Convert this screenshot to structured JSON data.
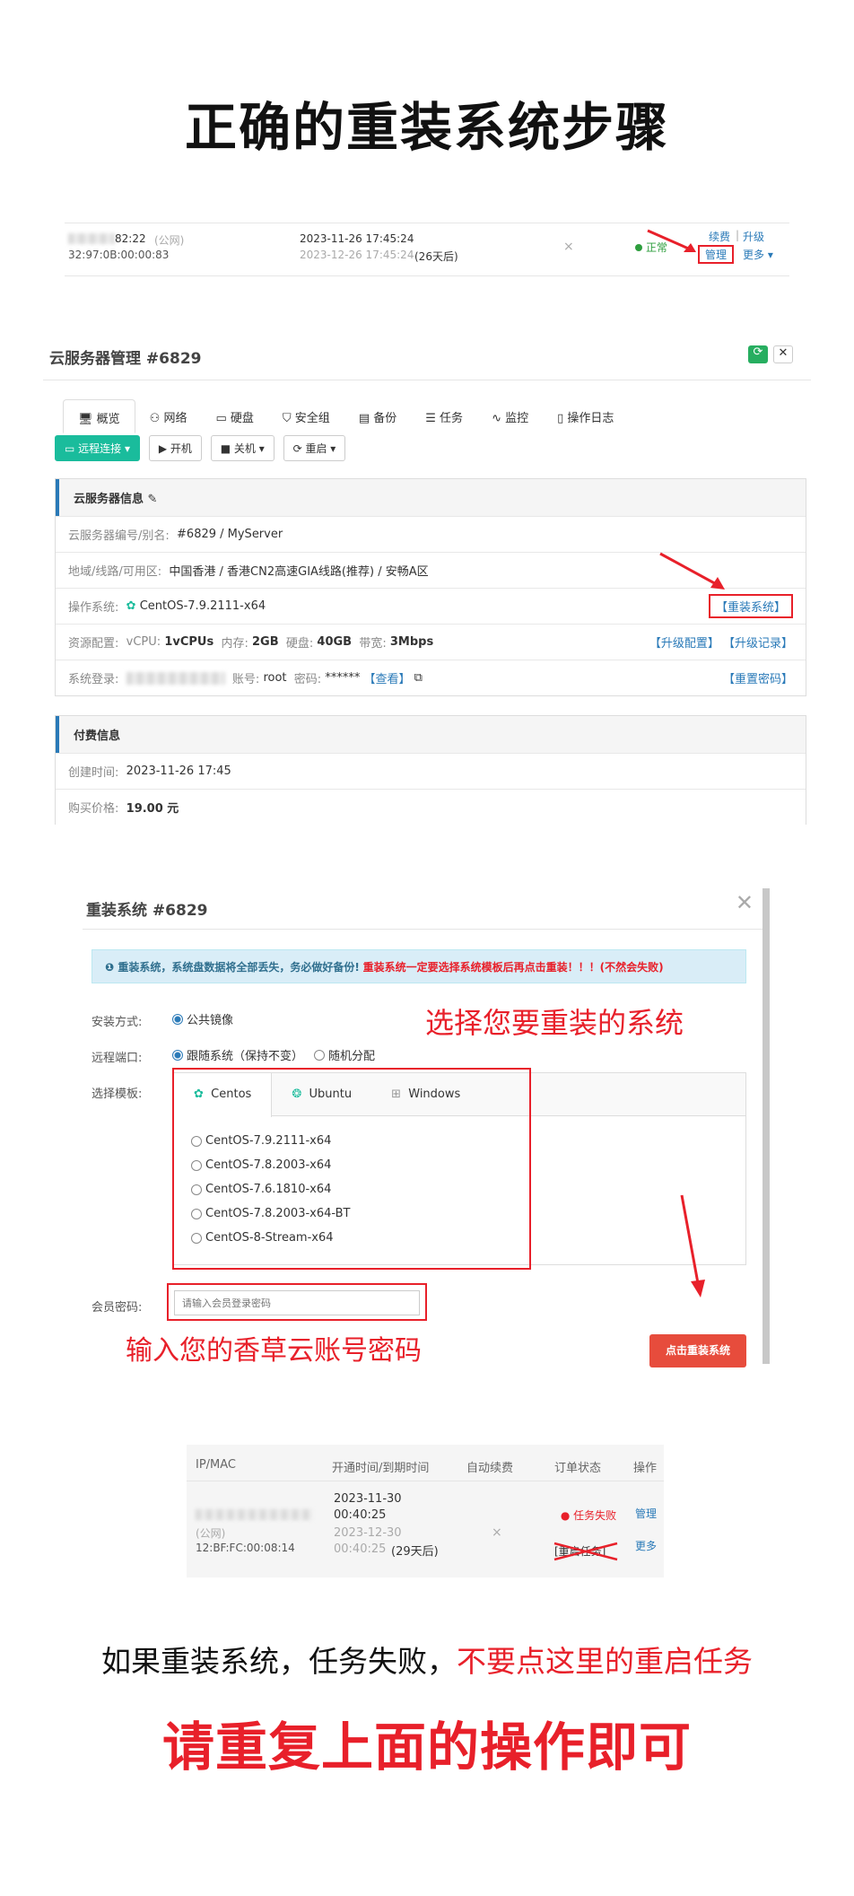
{
  "title": "正确的重装系统步骤",
  "list1": {
    "ip": "82:22",
    "ip_type": "(公网)",
    "mac": "32:97:0B:00:00:83",
    "open_time": "2023-11-26 17:45:24",
    "expire_time": "2023-12-26 17:45:24",
    "remain": "(26天后)",
    "auto_renew": "×",
    "status": "正常",
    "renew": "续费",
    "upgrade": "升级",
    "manage": "管理",
    "more": "更多"
  },
  "manage": {
    "title": "云服务器管理 #6829",
    "tabs": [
      "概览",
      "网络",
      "硬盘",
      "安全组",
      "备份",
      "任务",
      "监控",
      "操作日志"
    ],
    "buttons": {
      "remote": "远程连接",
      "start": "开机",
      "shutdown": "关机",
      "reboot": "重启"
    },
    "info_title": "云服务器信息",
    "rows": {
      "id_label": "云服务器编号/别名:",
      "id_value": "#6829 / MyServer",
      "region_label": "地域/线路/可用区:",
      "region_value": "中国香港 / 香港CN2高速GIA线路(推荐) / 安畅A区",
      "os_label": "操作系统:",
      "os_value": "CentOS-7.9.2111-x64",
      "reinstall": "【重装系统】",
      "res_label": "资源配置:",
      "cpu_label": "vCPU:",
      "cpu": "1vCPUs",
      "mem_label": "内存:",
      "mem": "2GB",
      "disk_label": "硬盘:",
      "disk": "40GB",
      "bw_label": "带宽:",
      "bw": "3Mbps",
      "upgrade_cfg": "【升级配置】",
      "upgrade_log": "【升级记录】",
      "login_label": "系统登录:",
      "account_label": "账号:",
      "account": "root",
      "pwd_label": "密码:",
      "pwd": "******",
      "view": "【查看】",
      "reset_pwd": "【重置密码】"
    },
    "pay_title": "付费信息",
    "created_label": "创建时间:",
    "created": "2023-11-26 17:45",
    "price_label": "购买价格:",
    "price": "19.00 元"
  },
  "reinstall": {
    "title": "重装系统 #6829",
    "notice": "重装系统，系统盘数据将全部丢失，务必做好备份!",
    "notice_red": "重装系统一定要选择系统模板后再点击重装！！！(不然会失败)",
    "install_label": "安装方式:",
    "install_opt": "公共镜像",
    "port_label": "远程端口:",
    "port_opt1": "跟随系统（保持不变）",
    "port_opt2": "随机分配",
    "tpl_label": "选择模板:",
    "tpl_tabs": [
      "Centos",
      "Ubuntu",
      "Windows"
    ],
    "os_list": [
      "CentOS-7.9.2111-x64",
      "CentOS-7.8.2003-x64",
      "CentOS-7.6.1810-x64",
      "CentOS-7.8.2003-x64-BT",
      "CentOS-8-Stream-x64"
    ],
    "pwd_label": "会员密码:",
    "pwd_placeholder": "请输入会员登录密码",
    "submit": "点击重装系统",
    "ann_select": "选择您要重装的系统",
    "ann_pwd": "输入您的香草云账号密码"
  },
  "list2": {
    "headers": [
      "IP/MAC",
      "开通时间/到期时间",
      "自动续费",
      "订单状态",
      "操作"
    ],
    "ip_type": "(公网)",
    "mac": "12:BF:FC:00:08:14",
    "open_time": "2023-11-30 00:40:25",
    "expire_time": "2023-12-30 00:40:25",
    "remain": "(29天后)",
    "auto_renew": "×",
    "status": "任务失败",
    "restart": "[重启任务]",
    "manage": "管理",
    "more": "更多"
  },
  "bottom": {
    "line1_black": "如果重装系统，任务失败，",
    "line1_red": "不要点这里的重启任务",
    "line2": "请重复上面的操作即可"
  },
  "colors": {
    "red": "#e8202a",
    "blue": "#2a7ab8",
    "teal": "#1abc9c"
  }
}
